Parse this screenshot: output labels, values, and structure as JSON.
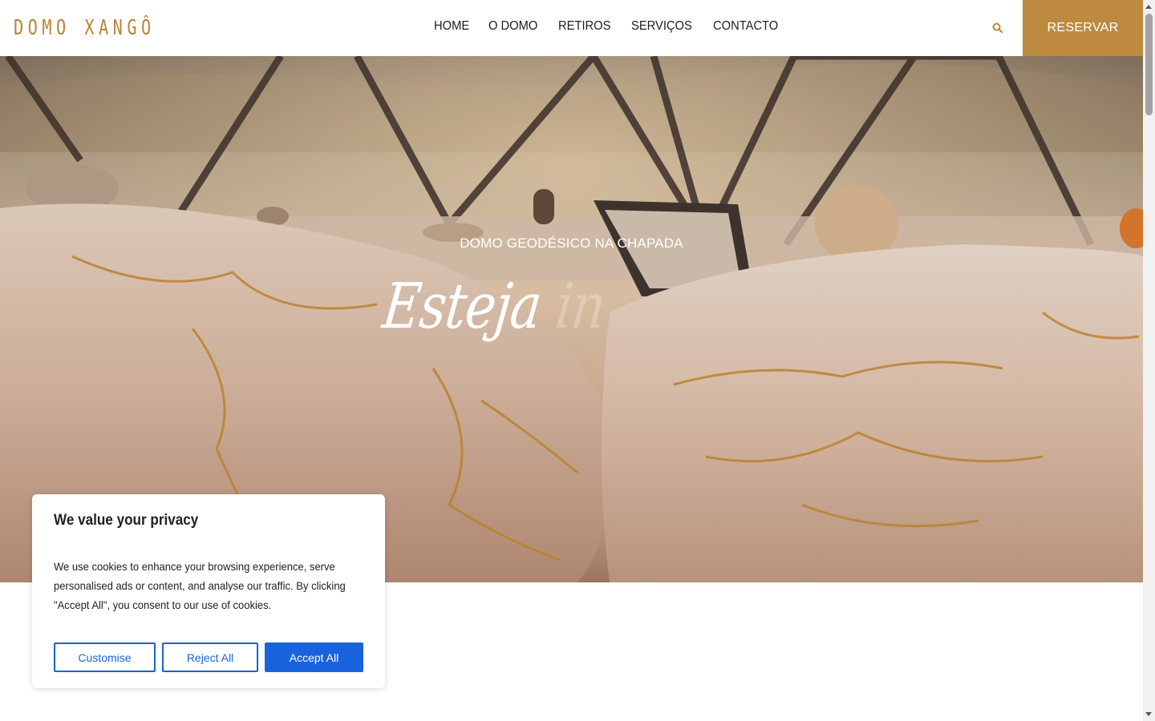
{
  "header": {
    "logo": "DOMO XANGÔ",
    "nav": [
      "HOME",
      "O DOMO",
      "RETIROS",
      "SERVIÇOS",
      "CONTACTO"
    ],
    "search_icon": "search-icon",
    "reserve_label": "RESERVAR"
  },
  "hero": {
    "subtitle": "DOMO GEODÉSICO NA CHAPADA",
    "script_visible": "Esteja",
    "script_faded": "in"
  },
  "cookie_banner": {
    "title": "We value your privacy",
    "text": "We use cookies to enhance your browsing experience, serve personalised ads or content, and analyse our traffic. By clicking \"Accept All\", you consent to our use of cookies.",
    "customise_label": "Customise",
    "reject_label": "Reject All",
    "accept_label": "Accept All"
  },
  "colors": {
    "brand_gold": "#bd8a3f",
    "consent_blue": "#1863dc"
  }
}
